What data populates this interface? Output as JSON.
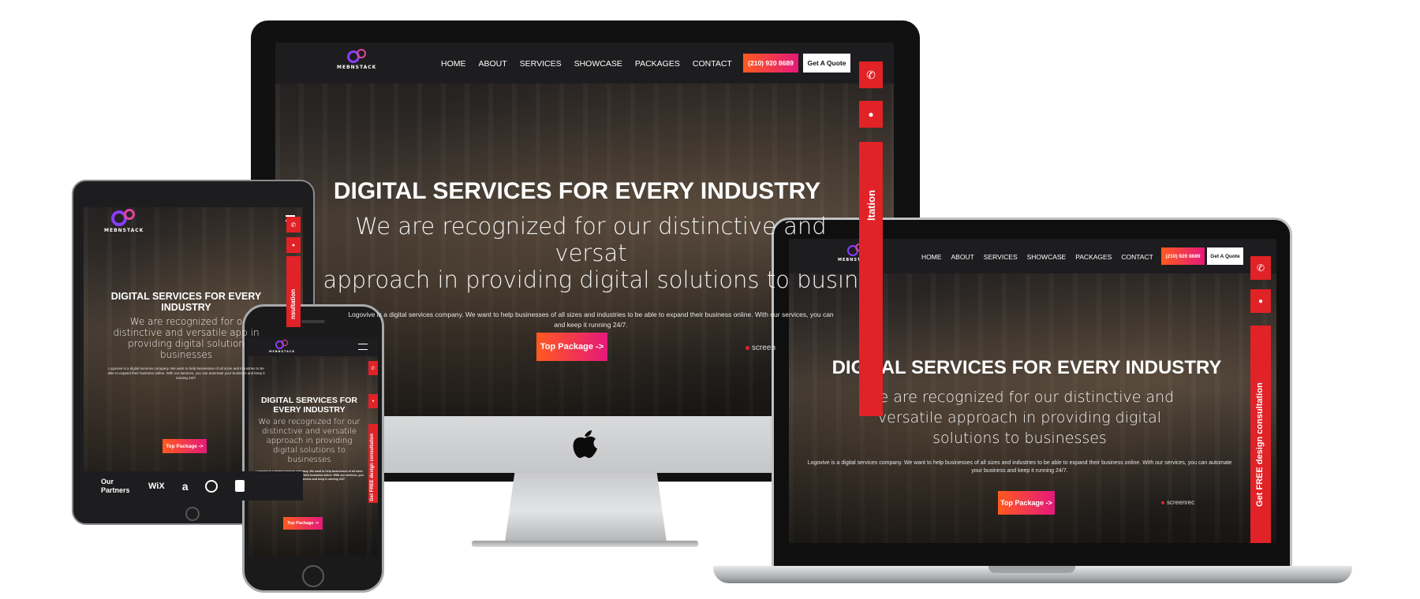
{
  "brand": {
    "logo_text": "MEBNSTACK"
  },
  "nav": {
    "items": [
      "HOME",
      "ABOUT",
      "SERVICES",
      "SHOWCASE",
      "PACKAGES",
      "CONTACT"
    ],
    "phone": "(210) 920 8689",
    "quote": "Get A Quote"
  },
  "side": {
    "consult_full": "Get FREE design consultation",
    "consult_partial": "ltation",
    "consult_tablet": "nsultation",
    "consult_phone": "Get FREE design consultation"
  },
  "hero": {
    "title": "DIGITAL SERVICES FOR EVERY INDUSTRY",
    "title_imac": "DIGITAL SERVICES FOR EVERY INDUSTRY",
    "sub": "We are recognized for our distinctive and versatile approach in providing digital solutions to businesses",
    "sub_imac_line1": "We are recognized for our distinctive and versat",
    "sub_imac_line2": "approach in providing digital solutions to busin",
    "body": "Logovive is a digital services company. We want to help businesses of all sizes and industries to be able to expand their business online. With our services, you can automate your business and keep it running 24/7.",
    "body_imac_line1": "Logovive is a digital services company. We want to help businesses of all sizes and industries to be able to expand their business online. With our services, you can",
    "body_imac_line2": "and keep it running 24/7.",
    "cta": "Top Package ->",
    "rec": "screenrec",
    "rec_partial": "screen"
  },
  "tablet": {
    "title": "DIGITAL SERVICES FOR EVERY INDUSTRY",
    "sub": "We are recognized for o distinctive and versatile app in providing digital solution businesses",
    "partners_label": "Our Partners",
    "partners": [
      "WiX",
      "a",
      "xbox",
      "shopify"
    ]
  },
  "phone": {
    "title": "DIGITAL SERVICES FOR EVERY INDUSTRY",
    "sub": "We are recognized for our distinctive and versatile approach in providing digital solutions to businesses",
    "body": "Logovive is a digital services company. We want to help businesses of all sizes and industries to be able to expand their business online. With our services, you can automate your business and keep it running 24/7."
  },
  "colors": {
    "accent_red": "#e12227",
    "gradient_start": "#ff5a1f",
    "gradient_end": "#e5197a",
    "logo_purple": "#8a3cff"
  }
}
